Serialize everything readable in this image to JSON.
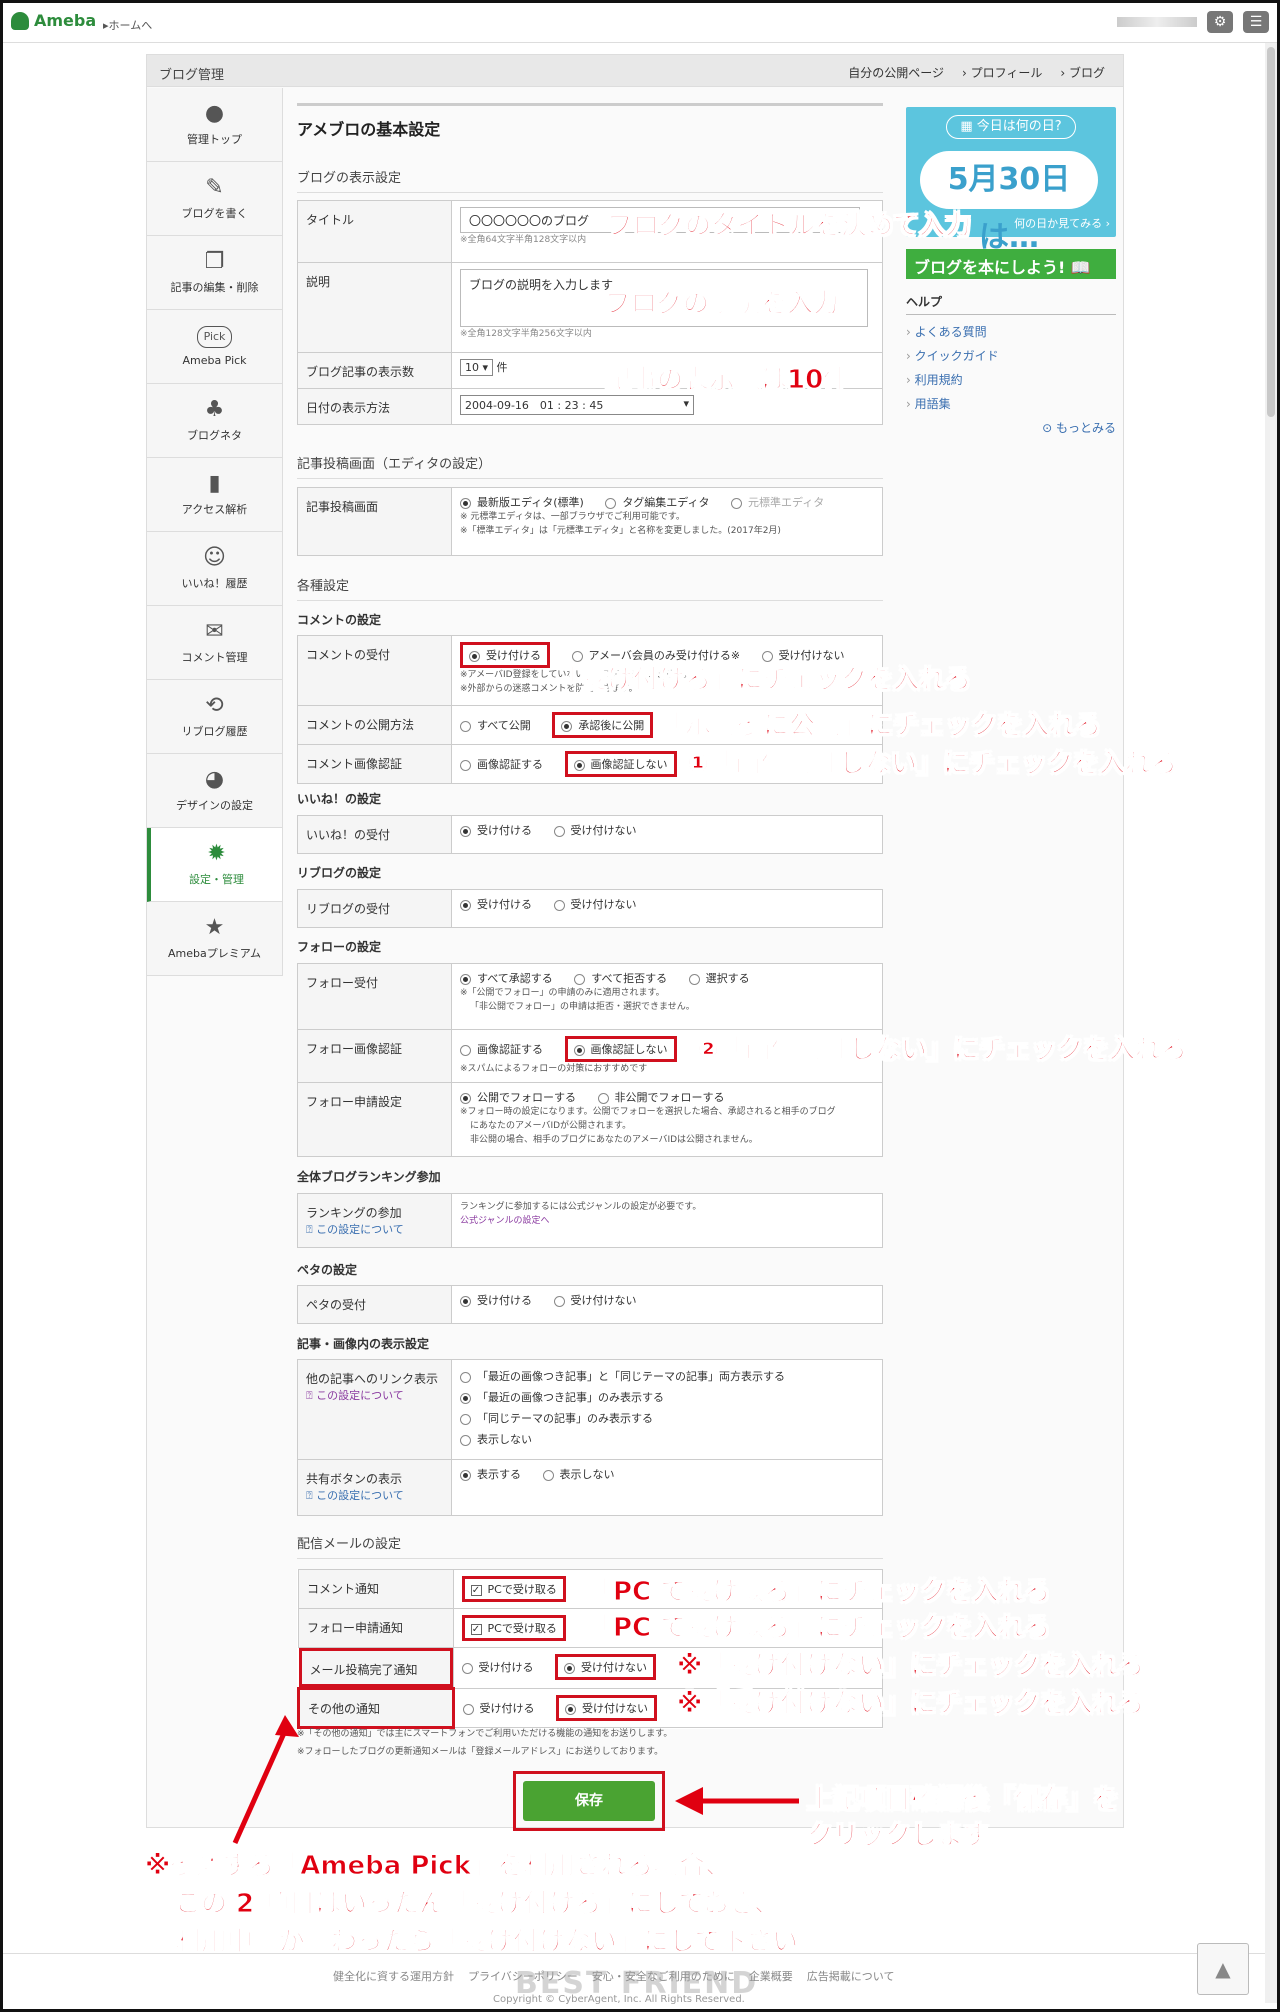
{
  "topbar": {
    "logo": "Ameba",
    "home_link": "▸ホームへ"
  },
  "shell": {
    "title": "ブログ管理",
    "head_links": [
      "自分の公開ページ",
      "プロフィール",
      "ブログ"
    ]
  },
  "sidebar": [
    {
      "label": "管理トップ",
      "icon": "person-icon"
    },
    {
      "label": "ブログを書く",
      "icon": "pencil-icon"
    },
    {
      "label": "記事の編集・削除",
      "icon": "documents-icon"
    },
    {
      "label": "Ameba Pick",
      "icon": "pick-icon"
    },
    {
      "label": "ブログネタ",
      "icon": "sprout-icon"
    },
    {
      "label": "アクセス解析",
      "icon": "bar-chart-icon"
    },
    {
      "label": "いいね！履歴",
      "icon": "smile-icon"
    },
    {
      "label": "コメント管理",
      "icon": "chat-icon"
    },
    {
      "label": "リブログ履歴",
      "icon": "reblog-icon"
    },
    {
      "label": "デザインの設定",
      "icon": "palette-icon"
    },
    {
      "label": "設定・管理",
      "icon": "gear-icon"
    },
    {
      "label": "Amebaプレミアム",
      "icon": "star-shield-icon"
    }
  ],
  "main": {
    "title": "アメブロの基本設定",
    "display_section": "ブログの表示設定",
    "title_label": "タイトル",
    "title_value": "〇〇〇〇〇〇のブログ",
    "title_note": "※全角64文字半角128文字以内",
    "desc_label": "説明",
    "desc_value": "ブログの説明を入力します",
    "desc_note": "※全角128文字半角256文字以内",
    "count_label": "ブログ記事の表示数",
    "count_value": "10 ▾",
    "count_unit": "件",
    "date_label": "日付の表示方法",
    "date_value": "2004-09-16　01 : 23 : 45",
    "editor_section": "記事投稿画面（エディタの設定）",
    "editor_label": "記事投稿画面",
    "editor_opts": [
      "最新版エディタ(標準)",
      "タグ編集エディタ",
      "元標準エディタ"
    ],
    "editor_note1": "※ 元標準エディタは、一部ブラウザでご利用可能です。",
    "editor_note2": "※「標準エディタ」は「元標準エディタ」と名称を変更しました。(2017年2月)",
    "misc_section": "各種設定",
    "comment_sub": "コメントの設定",
    "comment_accept_label": "コメントの受付",
    "comment_accept_opts": [
      "受け付ける",
      "アメーバ会員のみ受け付ける※",
      "受け付けない"
    ],
    "comment_accept_note1": "※アメーバID登録をしていない方はコメントできません。",
    "comment_accept_note2": "※外部からの迷惑コメントを防止できます。",
    "comment_public_label": "コメントの公開方法",
    "comment_public_opts": [
      "すべて公開",
      "承認後に公開"
    ],
    "comment_captcha_label": "コメント画像認証",
    "captcha_opts": [
      "画像認証する",
      "画像認証しない"
    ],
    "like_sub": "いいね！の設定",
    "like_label": "いいね！の受付",
    "accept_opts": [
      "受け付ける",
      "受け付けない"
    ],
    "reblog_sub": "リブログの設定",
    "reblog_label": "リブログの受付",
    "follow_sub": "フォローの設定",
    "follow_label": "フォロー受付",
    "follow_opts": [
      "すべて承認する",
      "すべて拒否する",
      "選択する"
    ],
    "follow_note1": "※「公開でフォロー」の申請のみに適用されます。",
    "follow_note2": "「非公開でフォロー」の申請は拒否・選択できません。",
    "follow_captcha_label": "フォロー画像認証",
    "follow_captcha_note": "※スパムによるフォローの対策におすすめです",
    "follow_req_label": "フォロー申請設定",
    "follow_req_opts": [
      "公開でフォローする",
      "非公開でフォローする"
    ],
    "follow_req_note1": "※フォロー時の設定になります。公開でフォローを選択した場合、承認されると相手のブログ",
    "follow_req_note2": "にあなたのアメーバIDが公開されます。",
    "follow_req_note3": "非公開の場合、相手のブログにあなたのアメーバIDは公開されません。",
    "ranking_sub": "全体ブログランキング参加",
    "ranking_label": "ランキングの参加",
    "ranking_help": "この設定について",
    "ranking_text": "ランキングに参加するには公式ジャンルの設定が必要です。",
    "ranking_link": "公式ジャンルの設定へ",
    "peta_sub": "ペタの設定",
    "peta_label": "ペタの受付",
    "display_sub": "記事・画像内の表示設定",
    "link_label": "他の記事へのリンク表示",
    "link_help": "この設定について",
    "link_opts": [
      "「最近の画像つき記事」と「同じテーマの記事」両方表示する",
      "「最近の画像つき記事」のみ表示する",
      "「同じテーマの記事」のみ表示する",
      "表示しない"
    ],
    "share_label": "共有ボタンの表示",
    "share_help": "この設定について",
    "share_opts": [
      "表示する",
      "表示しない"
    ],
    "mail_sub": "配信メールの設定",
    "mail_comment_label": "コメント通知",
    "mail_follow_label": "フォロー申請通知",
    "mail_post_label": "メール投稿完了通知",
    "mail_other_label": "その他の通知",
    "pc_receive": "PCで受け取る",
    "mail_note1": "※「その他の通知」では主にスマートフォンでご利用いただける機能の通知をお送りします。",
    "mail_note2": "※フォローしたブログの更新通知メールは「登録メールアドレス」にお送りしております。",
    "save": "保存"
  },
  "right": {
    "today_caption": "今日は何の日?",
    "today_date": "5月30日は…",
    "today_link": "何の日か見てみる ›",
    "banner": "ブログを本にしよう!",
    "help_title": "ヘルプ",
    "help_items": [
      "よくある質問",
      "クイックガイド",
      "利用規約",
      "用語集"
    ],
    "more": "もっとみる"
  },
  "annotations": {
    "a1": "ブログのタイトルを決めて入力",
    "a2": "ブログの説明を入力",
    "a3": "記事の表示数は10件",
    "a4": "「受け付ける」にチェックを入れる",
    "a5": "「承認後に公開」にチェックを入れる",
    "a6": "①「画像認証しない」にチェックを入れる",
    "a7": "②「画像認証しない」にチェックを入れる",
    "a8": "「PC で受け取る」にチェックを入れる",
    "a9": "「PC で受け取る」にチェックを入れる",
    "a10": "※「受け付けない」にチェックを入れる",
    "a11": "※「受け付けない」にチェックを入れる",
    "a12_1": "上記項目確認後「保存」を",
    "a12_2": "クリックします。",
    "a13_1": "※後述する「Ameba Pick」を利用される場合、",
    "a13_2": "この 2 項目はいったん「受け付ける」にしておき、",
    "a13_3": "利用申請が終わったら「受け付けない」にして下さい。"
  },
  "footer": {
    "links": [
      "健全化に資する運用方針",
      "プライバシーポリシー",
      "安心・安全なご利用のために",
      "企業概要",
      "広告掲載について"
    ],
    "copy": "Copyright © CyberAgent, Inc. All Rights Reserved.",
    "watermark": "BEST FRIEND"
  },
  "colors": {
    "accent": "#2d8c3c",
    "annotation": "#e00010",
    "save": "#4aa332"
  }
}
